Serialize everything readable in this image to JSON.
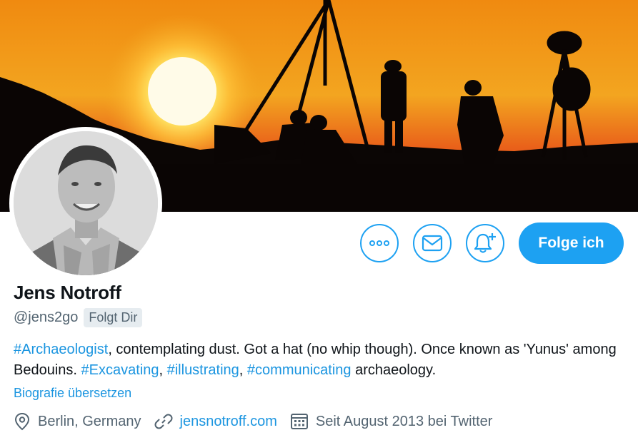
{
  "profile": {
    "name": "Jens Notroff",
    "handle": "@jens2go",
    "follows_you_badge": "Folgt Dir"
  },
  "bio": {
    "tag_archaeologist": "#Archaeologist",
    "text_1": ", contemplating dust. Got a hat (no whip though). Once known as 'Yunus' among Bedouins. ",
    "tag_excavating": "#Excavating",
    "sep_1": ", ",
    "tag_illustrating": "#illustrating",
    "sep_2": ", ",
    "tag_communicating": "#communicating",
    "text_2": " archaeology."
  },
  "translate_link": "Biografie übersetzen",
  "meta": {
    "location": "Berlin, Germany",
    "website": "jensnotroff.com",
    "joined": "Seit August 2013 bei Twitter"
  },
  "actions": {
    "more_icon": "more-icon",
    "message_icon": "mail-icon",
    "notify_icon": "bell-plus-icon",
    "follow_label": "Folge ich"
  },
  "colors": {
    "accent": "#1da1f2",
    "link": "#1b95e0",
    "secondary_text": "#536471"
  }
}
